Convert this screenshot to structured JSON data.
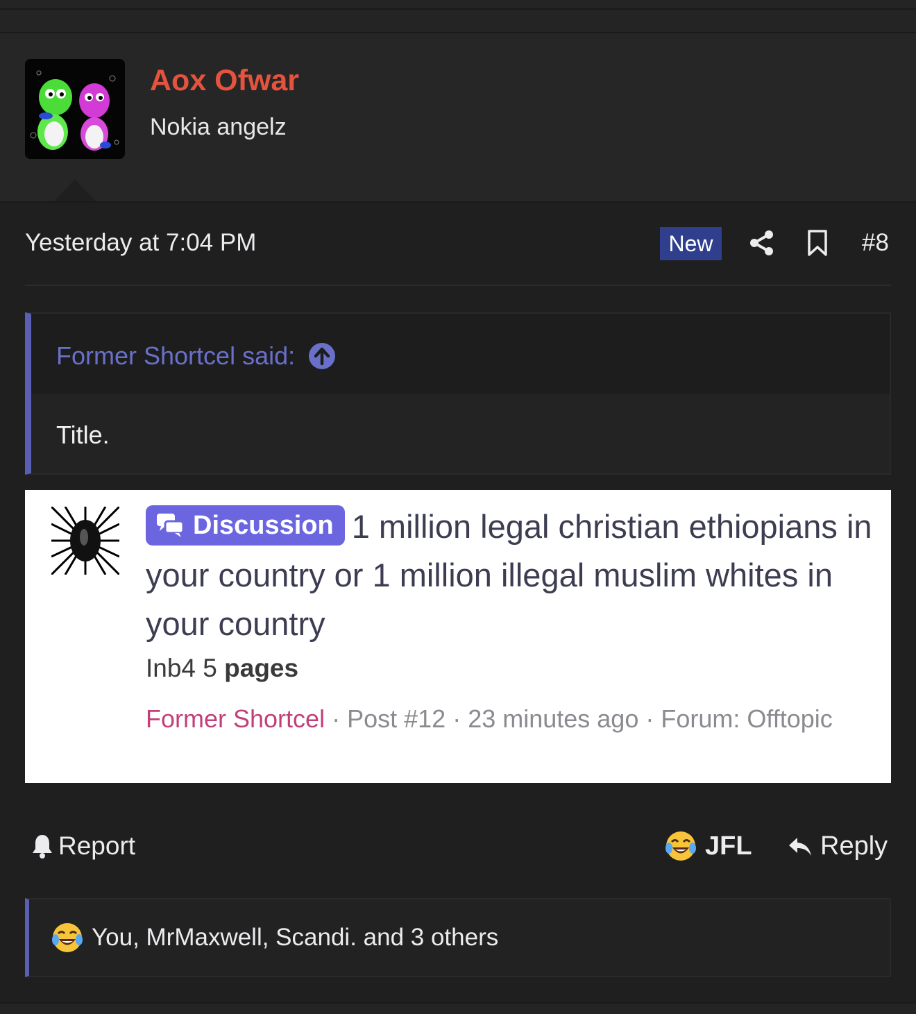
{
  "user": {
    "name": "Aox Ofwar",
    "title": "Nokia angelz"
  },
  "post": {
    "timestamp": "Yesterday at 7:04 PM",
    "new_badge": "New",
    "number": "#8"
  },
  "quote": {
    "attribution": "Former Shortcel said:",
    "text": "Title."
  },
  "embed": {
    "prefix": "Discussion",
    "title": "1 million legal christian ethiopians in your country or 1 million illegal muslim whites in your country",
    "snippet_plain": "Inb4 5 ",
    "snippet_bold": "pages",
    "author": "Former Shortcel",
    "sep1": " · ",
    "post_ref": "Post #12",
    "sep2": " · ",
    "time": "23 minutes ago",
    "sep3": " · ",
    "forum": "Forum: Offtopic"
  },
  "actions": {
    "report": "Report",
    "reaction": "JFL",
    "reply": "Reply"
  },
  "reactions_summary": "You, MrMaxwell, Scandi. and 3 others",
  "colors": {
    "background": "#1f1f20",
    "username": "#e5533e",
    "accent": "#5a5fb3",
    "new_badge": "#2f3f8d",
    "discussion_badge": "#6b66e0",
    "embed_author": "#c2407a"
  }
}
